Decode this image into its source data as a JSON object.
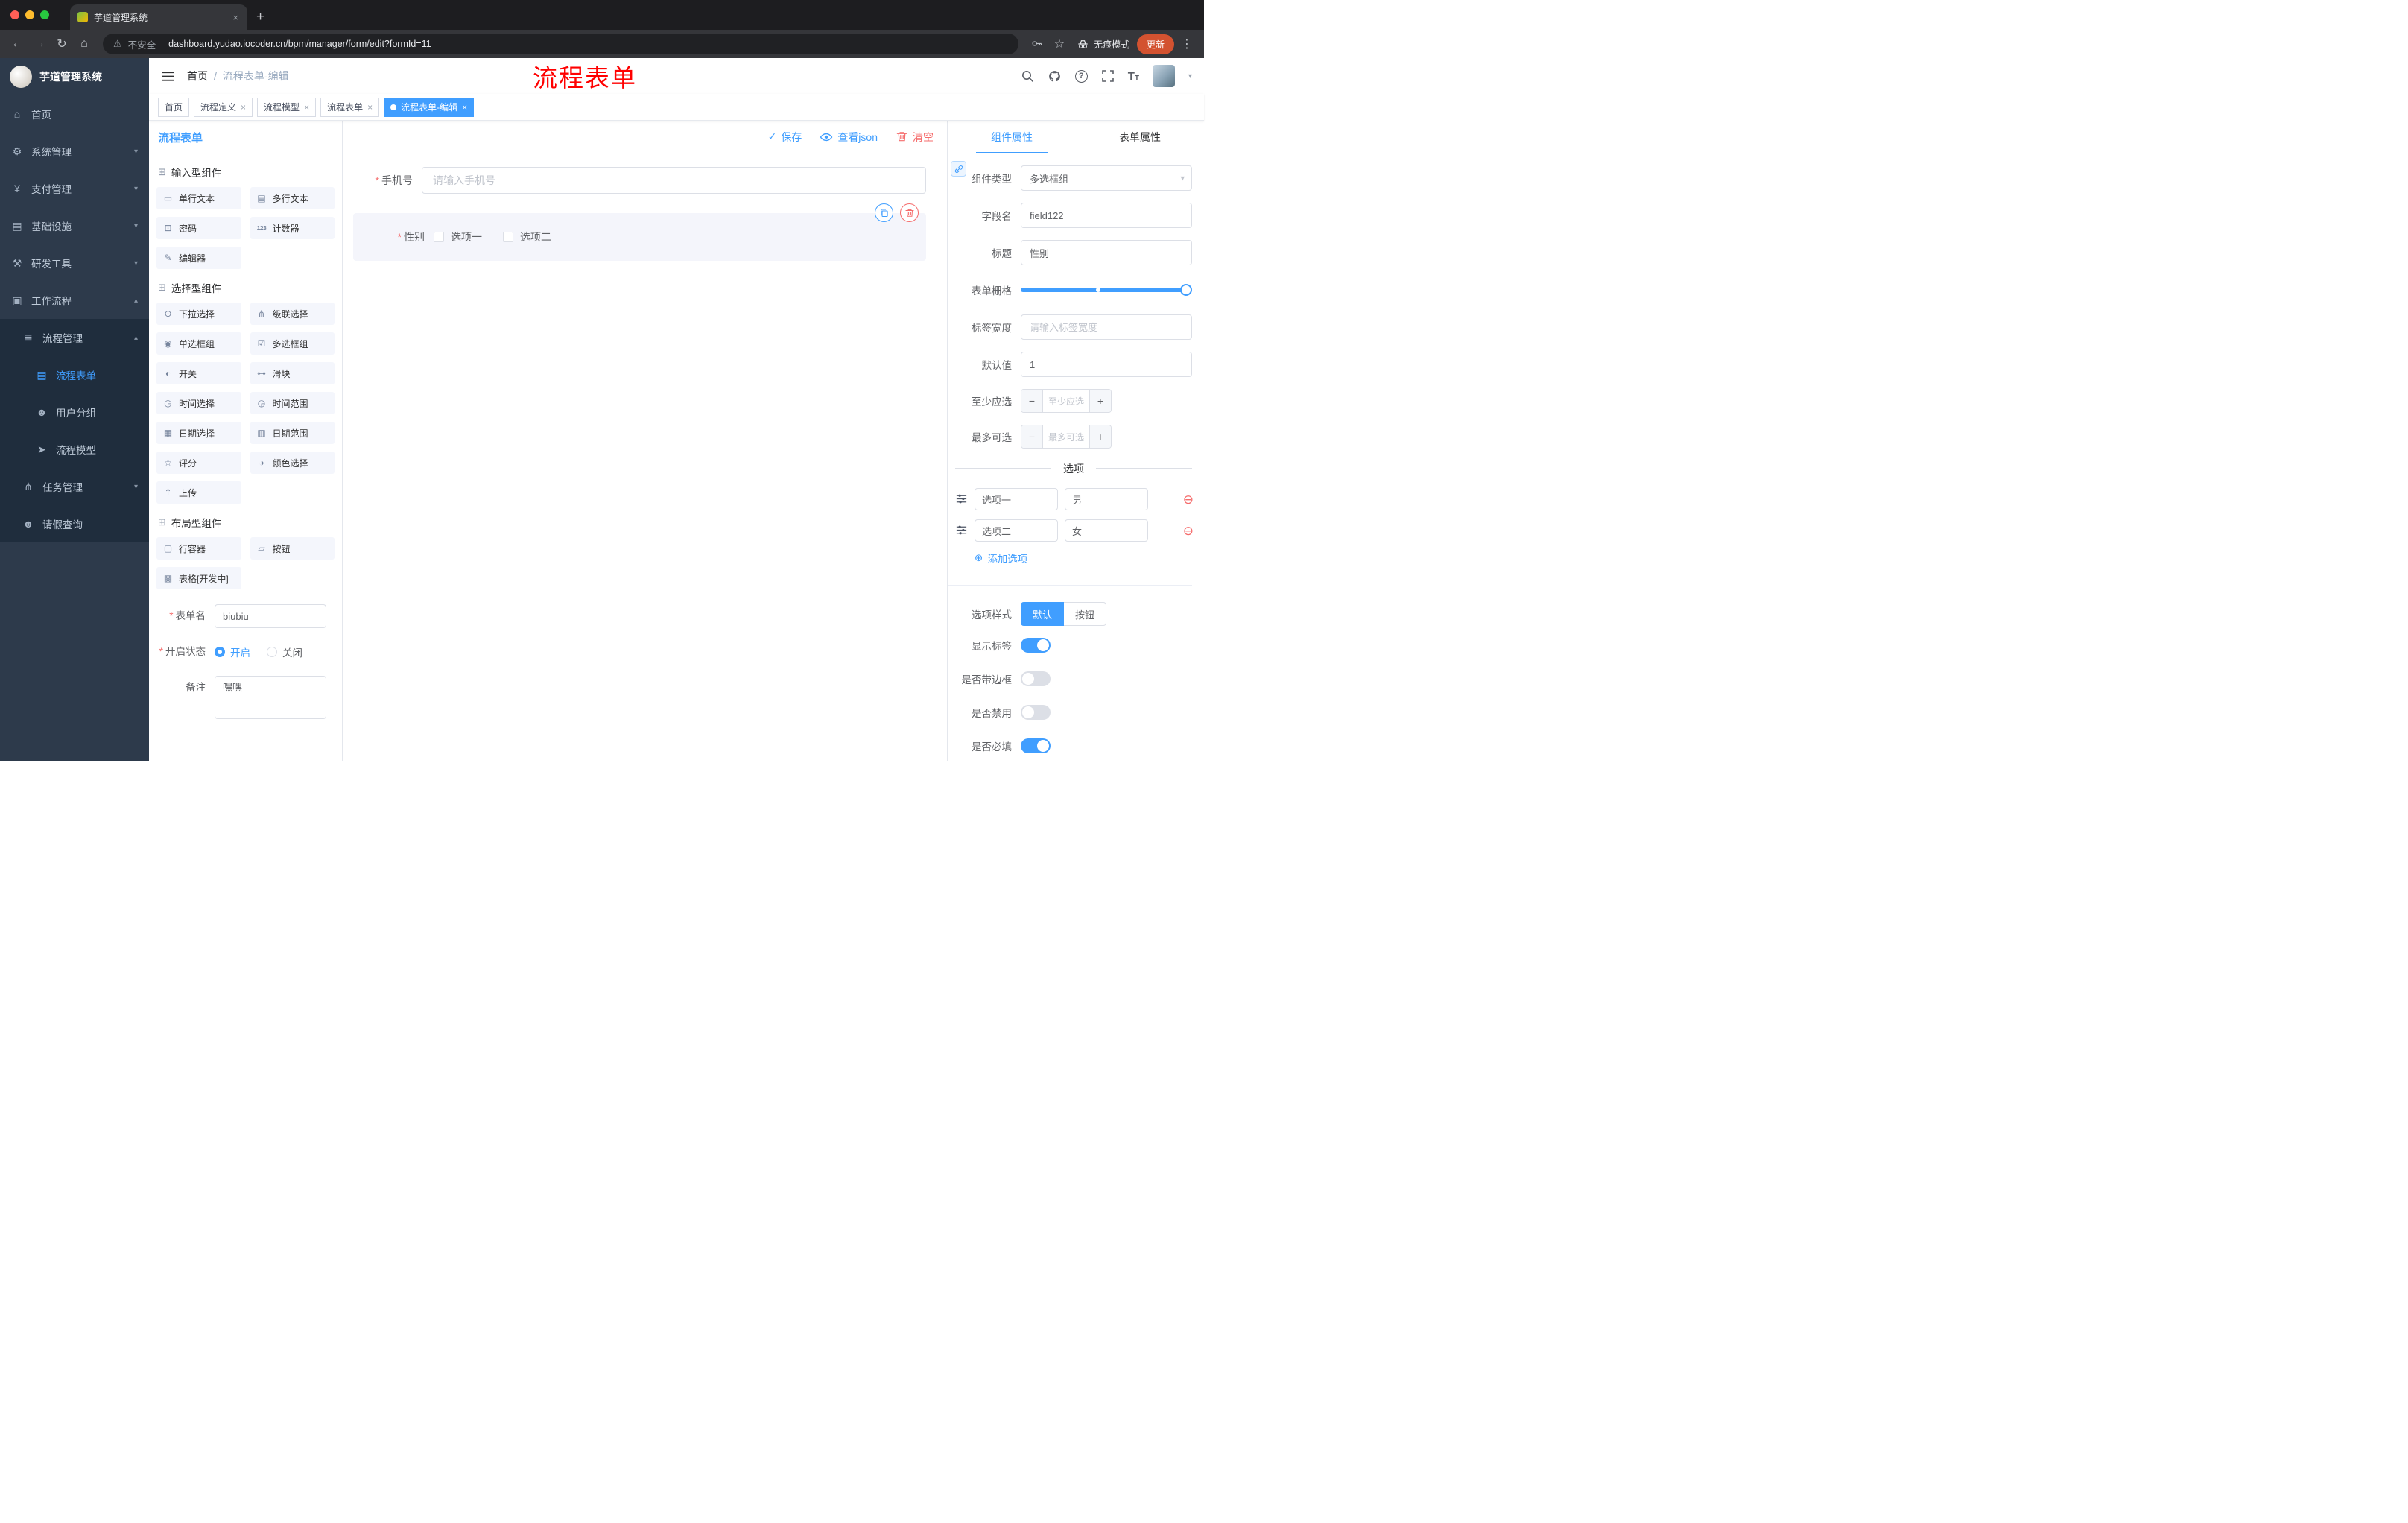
{
  "annotation": {
    "title": "流程表单"
  },
  "icons": {
    "back": "←",
    "forward": "→",
    "reload": "↻",
    "home": "⌂",
    "close": "×",
    "new_tab": "+",
    "star": "☆",
    "menu_dots": "⋮",
    "caret_down": "▾",
    "caret_up": "▴",
    "question": "?",
    "check": "✓",
    "warning": "⚠",
    "font_big": "T",
    "font_small": "T",
    "plus_circle": "⊕",
    "minus_circle": "⊖",
    "required": "*",
    "select_caret": "▾",
    "minus": "−",
    "plus": "+"
  },
  "browser": {
    "tab_title": "芋道管理系统",
    "security": "不安全",
    "url": "dashboard.yudao.iocoder.cn/bpm/manager/form/edit?formId=11",
    "incognito": "无痕模式",
    "update": "更新"
  },
  "sidebar": {
    "logo": "芋道管理系统",
    "items": [
      {
        "label": "首页",
        "icon": "⌂"
      },
      {
        "label": "系统管理",
        "icon": "⚙"
      },
      {
        "label": "支付管理",
        "icon": "¥"
      },
      {
        "label": "基础设施",
        "icon": "▤"
      },
      {
        "label": "研发工具",
        "icon": "⚒"
      },
      {
        "label": "工作流程",
        "icon": "▣"
      },
      {
        "label": "流程管理",
        "icon": "≣"
      },
      {
        "label": "流程表单",
        "icon": "▤"
      },
      {
        "label": "用户分组",
        "icon": "☻"
      },
      {
        "label": "流程模型",
        "icon": "➤"
      },
      {
        "label": "任务管理",
        "icon": "⋔"
      },
      {
        "label": "请假查询",
        "icon": "☻"
      }
    ]
  },
  "header": {
    "breadcrumb_home": "首页",
    "breadcrumb_sep": "/",
    "breadcrumb_current": "流程表单-编辑"
  },
  "tags": [
    {
      "label": "首页"
    },
    {
      "label": "流程定义"
    },
    {
      "label": "流程模型"
    },
    {
      "label": "流程表单"
    },
    {
      "label": "流程表单-编辑"
    }
  ],
  "designer": {
    "title": "流程表单",
    "groups": [
      {
        "title": "输入型组件",
        "icon": "⊞",
        "items": [
          {
            "label": "单行文本",
            "icon": "▭"
          },
          {
            "label": "多行文本",
            "icon": "▤"
          },
          {
            "label": "密码",
            "icon": "⊡"
          },
          {
            "label": "计数器",
            "icon": "123"
          },
          {
            "label": "编辑器",
            "icon": "✎"
          }
        ]
      },
      {
        "title": "选择型组件",
        "icon": "⊞",
        "items": [
          {
            "label": "下拉选择",
            "icon": "⊙"
          },
          {
            "label": "级联选择",
            "icon": "⋔"
          },
          {
            "label": "单选框组",
            "icon": "◉"
          },
          {
            "label": "多选框组",
            "icon": "☑"
          },
          {
            "label": "开关",
            "icon": "◐"
          },
          {
            "label": "滑块",
            "icon": "⊶"
          },
          {
            "label": "时间选择",
            "icon": "◷"
          },
          {
            "label": "时间范围",
            "icon": "◶"
          },
          {
            "label": "日期选择",
            "icon": "▦"
          },
          {
            "label": "日期范围",
            "icon": "▥"
          },
          {
            "label": "评分",
            "icon": "☆"
          },
          {
            "label": "颜色选择",
            "icon": "◑"
          },
          {
            "label": "上传",
            "icon": "↥"
          }
        ]
      },
      {
        "title": "布局型组件",
        "icon": "⊞",
        "items": [
          {
            "label": "行容器",
            "icon": "▢"
          },
          {
            "label": "按钮",
            "icon": "▱"
          },
          {
            "label": "表格[开发中]",
            "icon": "▩"
          }
        ]
      }
    ],
    "meta": {
      "name_label": "表单名",
      "name_value": "biubiu",
      "status_label": "开启状态",
      "status_on": "开启",
      "status_off": "关闭",
      "remark_label": "备注",
      "remark_value": "嘿嘿"
    }
  },
  "toolbar": {
    "save": "保存",
    "view_json": "查看json",
    "clear": "清空"
  },
  "canvas": {
    "phone": {
      "label": "手机号",
      "placeholder": "请输入手机号"
    },
    "gender": {
      "label": "性别",
      "option1": "选项一",
      "option2": "选项二"
    }
  },
  "props": {
    "tab_component": "组件属性",
    "tab_form": "表单属性",
    "type_label": "组件类型",
    "type_value": "多选框组",
    "field_label": "字段名",
    "field_value": "field122",
    "title_label": "标题",
    "title_value": "性别",
    "grid_label": "表单栅格",
    "width_label": "标签宽度",
    "width_placeholder": "请输入标签宽度",
    "default_label": "默认值",
    "default_value": "1",
    "min_label": "至少应选",
    "min_placeholder": "至少应选",
    "max_label": "最多可选",
    "max_placeholder": "最多可选",
    "options_divider": "选项",
    "options": [
      {
        "label": "选项一",
        "value": "男"
      },
      {
        "label": "选项二",
        "value": "女"
      }
    ],
    "add_option": "添加选项",
    "style_label": "选项样式",
    "style_default": "默认",
    "style_button": "按钮",
    "toggle_show_label": "显示标签",
    "toggle_border": "是否带边框",
    "toggle_disabled": "是否禁用",
    "toggle_required": "是否必填"
  },
  "colors": {
    "primary": "#409EFF",
    "danger": "#F56C6C",
    "annotation": "#FF0000"
  }
}
